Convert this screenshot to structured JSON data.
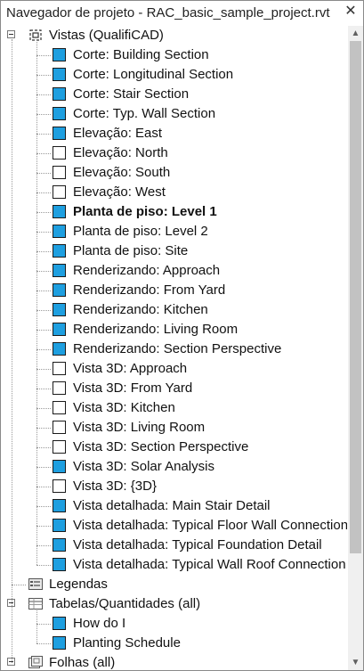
{
  "window": {
    "title": "Navegador de projeto - RAC_basic_sample_project.rvt",
    "close_glyph": "✕"
  },
  "tree": {
    "views_root": {
      "label": "Vistas (QualifiCAD)",
      "icon": "views-icon"
    },
    "views": [
      {
        "label": "Corte: Building Section",
        "icon_state": "filled",
        "bold": false
      },
      {
        "label": "Corte: Longitudinal Section",
        "icon_state": "filled",
        "bold": false
      },
      {
        "label": "Corte: Stair Section",
        "icon_state": "filled",
        "bold": false
      },
      {
        "label": "Corte: Typ. Wall Section",
        "icon_state": "filled",
        "bold": false
      },
      {
        "label": "Elevação: East",
        "icon_state": "filled",
        "bold": false
      },
      {
        "label": "Elevação: North",
        "icon_state": "empty",
        "bold": false
      },
      {
        "label": "Elevação: South",
        "icon_state": "empty",
        "bold": false
      },
      {
        "label": "Elevação: West",
        "icon_state": "empty",
        "bold": false
      },
      {
        "label": "Planta de piso: Level 1",
        "icon_state": "filled",
        "bold": true
      },
      {
        "label": "Planta de piso: Level 2",
        "icon_state": "filled",
        "bold": false
      },
      {
        "label": "Planta de piso: Site",
        "icon_state": "filled",
        "bold": false
      },
      {
        "label": "Renderizando: Approach",
        "icon_state": "filled",
        "bold": false
      },
      {
        "label": "Renderizando: From Yard",
        "icon_state": "filled",
        "bold": false
      },
      {
        "label": "Renderizando: Kitchen",
        "icon_state": "filled",
        "bold": false
      },
      {
        "label": "Renderizando: Living Room",
        "icon_state": "filled",
        "bold": false
      },
      {
        "label": "Renderizando: Section Perspective",
        "icon_state": "filled",
        "bold": false
      },
      {
        "label": "Vista 3D: Approach",
        "icon_state": "empty",
        "bold": false
      },
      {
        "label": "Vista 3D: From Yard",
        "icon_state": "empty",
        "bold": false
      },
      {
        "label": "Vista 3D: Kitchen",
        "icon_state": "empty",
        "bold": false
      },
      {
        "label": "Vista 3D: Living Room",
        "icon_state": "empty",
        "bold": false
      },
      {
        "label": "Vista 3D: Section Perspective",
        "icon_state": "empty",
        "bold": false
      },
      {
        "label": "Vista 3D: Solar Analysis",
        "icon_state": "filled",
        "bold": false
      },
      {
        "label": "Vista 3D: {3D}",
        "icon_state": "empty",
        "bold": false
      },
      {
        "label": "Vista detalhada: Main Stair Detail",
        "icon_state": "filled",
        "bold": false
      },
      {
        "label": "Vista detalhada: Typical Floor Wall Connection",
        "icon_state": "filled",
        "bold": false
      },
      {
        "label": "Vista detalhada: Typical Foundation Detail",
        "icon_state": "filled",
        "bold": false
      },
      {
        "label": "Vista detalhada: Typical Wall Roof Connection",
        "icon_state": "filled",
        "bold": false
      }
    ],
    "legends": {
      "label": "Legendas",
      "icon": "legend-icon"
    },
    "schedules_root": {
      "label": "Tabelas/Quantidades (all)",
      "icon": "table-icon"
    },
    "schedules": [
      {
        "label": "How do I",
        "icon_state": "filled"
      },
      {
        "label": "Planting Schedule",
        "icon_state": "filled"
      }
    ],
    "sheets": {
      "label": "Folhas (all)",
      "icon": "sheets-icon"
    }
  },
  "colors": {
    "accent_view_icon": "#1e9fe0",
    "scroll_thumb": "#c2c2c2",
    "scroll_track": "#f0f0f0"
  }
}
